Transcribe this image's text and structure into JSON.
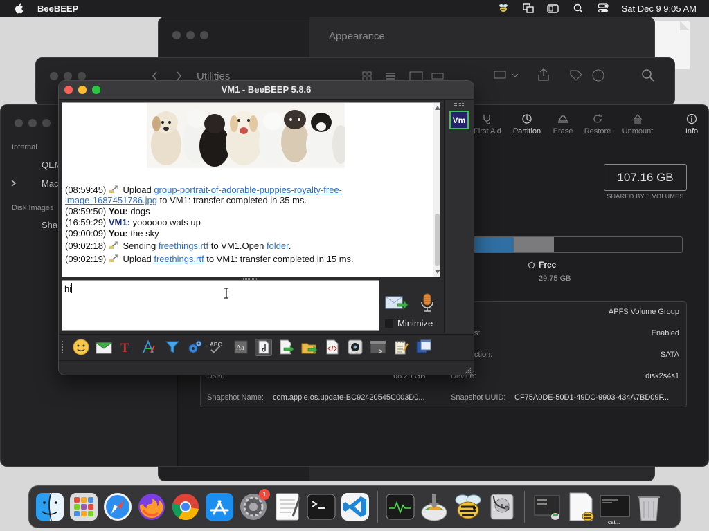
{
  "menubar": {
    "app_name": "BeeBEEP",
    "clock": "Sat Dec 9  9:05 AM",
    "icons": [
      "bee-icon",
      "screen-mirror-icon",
      "window-icon",
      "search-icon",
      "control-center-icon"
    ]
  },
  "background_windows": {
    "appearance_title": "Appearance",
    "utilities_title": "Utilities"
  },
  "disk_utility": {
    "sidebar": {
      "internal_header": "Internal",
      "item_qemu": "QEM",
      "item_mac": "Mac",
      "disk_images_header": "Disk Images",
      "item_shared": "Shar"
    },
    "toolbar": {
      "first_aid": "First Aid",
      "partition": "Partition",
      "erase": "Erase",
      "restore": "Restore",
      "unmount": "Unmount",
      "info": "Info"
    },
    "capacity": "107.16 GB",
    "shared_label": "SHARED BY 5 VOLUMES",
    "usage": {
      "used_fraction": 0.2,
      "other_fraction": 0.19
    },
    "free_label": "Free",
    "free_value": "29.75 GB",
    "info_rows": [
      {
        "left_label": "",
        "left_value": "",
        "right_label": "",
        "right_value": "APFS Volume Group"
      },
      {
        "left_label": "",
        "left_value": "",
        "right_label": "s:",
        "right_value": "Enabled"
      },
      {
        "left_label": "",
        "left_value": "",
        "right_label": "ction:",
        "right_value": "SATA"
      },
      {
        "left_label": "Used:",
        "left_value": "68.25 GB",
        "right_label": "Device:",
        "right_value": "disk2s4s1"
      },
      {
        "left_label": "Snapshot Name:",
        "left_value": "com.apple.os.update-BC92420545C003D0...",
        "right_label": "Snapshot UUID:",
        "right_value": "CF75A0DE-50D1-49DC-9903-434A7BD09F..."
      }
    ]
  },
  "beebeep": {
    "window_title": "VM1 - BeeBEEP 5.8.6",
    "messages": [
      {
        "time": "(08:59:45)",
        "pre": "Upload ",
        "link1": "group-portrait-of-adorable-puppies-royalty-free-",
        "link2": "image-1687451786.jpg",
        "post": " to VM1: transfer completed in 35 ms."
      },
      {
        "time": "(08:59:50)",
        "user": "You:",
        "text": " dogs"
      },
      {
        "time": "(16:59:29)",
        "user": "VM1:",
        "text": " yoooooo wats up"
      },
      {
        "time": "(09:00:09)",
        "user": "You:",
        "text": " the sky"
      },
      {
        "time": "(09:02:18)",
        "pre": "Sending ",
        "link1": "freethings.rtf",
        "mid": " to VM1.Open ",
        "link2": "folder",
        "post": "."
      },
      {
        "time": "(09:02:19)",
        "pre": "Upload ",
        "link1": "freethings.rtf",
        "post": " to VM1: transfer completed in 15 ms."
      }
    ],
    "input_value": "hi",
    "minimize_label": "Minimize",
    "user_badge": "Vm",
    "toolbar_icons": [
      "emoji-icon",
      "envelope-icon",
      "text-color-icon",
      "font-icon",
      "filter-icon",
      "gear-cluster-icon",
      "spellcheck-icon",
      "font-box-icon",
      "note-icon",
      "send-file-icon",
      "share-folder-icon",
      "code-icon",
      "screenshot-icon",
      "terminal-icon",
      "notepad-icon",
      "window-share-icon"
    ]
  },
  "dock": {
    "apps": [
      "finder-icon",
      "launchpad-icon",
      "safari-icon",
      "firefox-icon",
      "chrome-icon",
      "app-store-icon",
      "system-preferences-icon",
      "textedit-icon",
      "terminal-icon",
      "vscode-icon",
      "activity-monitor-icon",
      "disk-image-icon",
      "beebeep-icon",
      "disk-utility-icon",
      "recent-icon-1",
      "recent-icon-2",
      "recent-icon-3",
      "trash-icon"
    ],
    "settings_badge": "1",
    "cat_label": "cat..."
  }
}
